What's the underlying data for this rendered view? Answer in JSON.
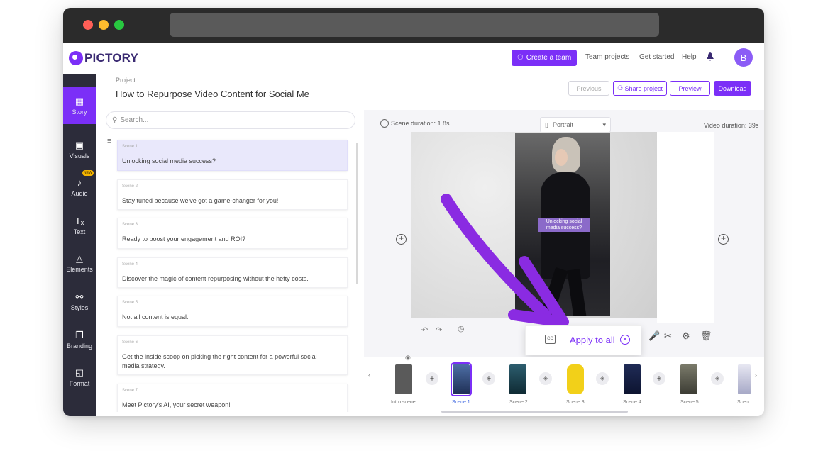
{
  "app": {
    "brand": "PICTORY",
    "nav": {
      "create_team": "Create a team",
      "team_projects": "Team projects",
      "get_started": "Get started",
      "help": "Help",
      "avatar_initial": "B"
    }
  },
  "sidebar": {
    "items": [
      {
        "label": "Story",
        "icon": "grid-icon"
      },
      {
        "label": "Visuals",
        "icon": "image-icon"
      },
      {
        "label": "Audio",
        "icon": "music-icon",
        "badge": "NEW"
      },
      {
        "label": "Text",
        "icon": "text-icon"
      },
      {
        "label": "Elements",
        "icon": "shapes-icon"
      },
      {
        "label": "Styles",
        "icon": "palette-icon"
      },
      {
        "label": "Branding",
        "icon": "brand-icon"
      },
      {
        "label": "Format",
        "icon": "format-icon"
      }
    ]
  },
  "project": {
    "label": "Project",
    "title": "How to Repurpose Video Content for Social Me"
  },
  "toolbar": {
    "previous": "Previous",
    "share": "Share project",
    "preview": "Preview",
    "download": "Download"
  },
  "search": {
    "placeholder": "Search..."
  },
  "scenes": [
    {
      "num": "Scene 1",
      "text": "Unlocking social media success?"
    },
    {
      "num": "Scene 2",
      "text": "Stay tuned because we've got a game-changer for you!"
    },
    {
      "num": "Scene 3",
      "text": "Ready to boost your engagement and ROI?"
    },
    {
      "num": "Scene 4",
      "text": "Discover the magic of content repurposing without the hefty costs."
    },
    {
      "num": "Scene 5",
      "text": "Not all content is equal."
    },
    {
      "num": "Scene 6",
      "text": "Get the inside scoop on picking the right content for a powerful social media strategy."
    },
    {
      "num": "Scene 7",
      "text": "Meet Pictory's AI, your secret weapon!"
    }
  ],
  "editor": {
    "scene_duration": "Scene duration: 1.8s",
    "format": "Portrait",
    "video_duration": "Video duration: 39s",
    "caption": "Unlocking social media success?",
    "apply_to_all": "Apply to all"
  },
  "timeline": {
    "labels": [
      "Intro scene",
      "Scene 1",
      "Scene 2",
      "Scene 3",
      "Scene 4",
      "Scene 5",
      "Scen"
    ]
  },
  "colors": {
    "accent": "#7b2ff7",
    "sidebar": "#2c2c3a"
  }
}
